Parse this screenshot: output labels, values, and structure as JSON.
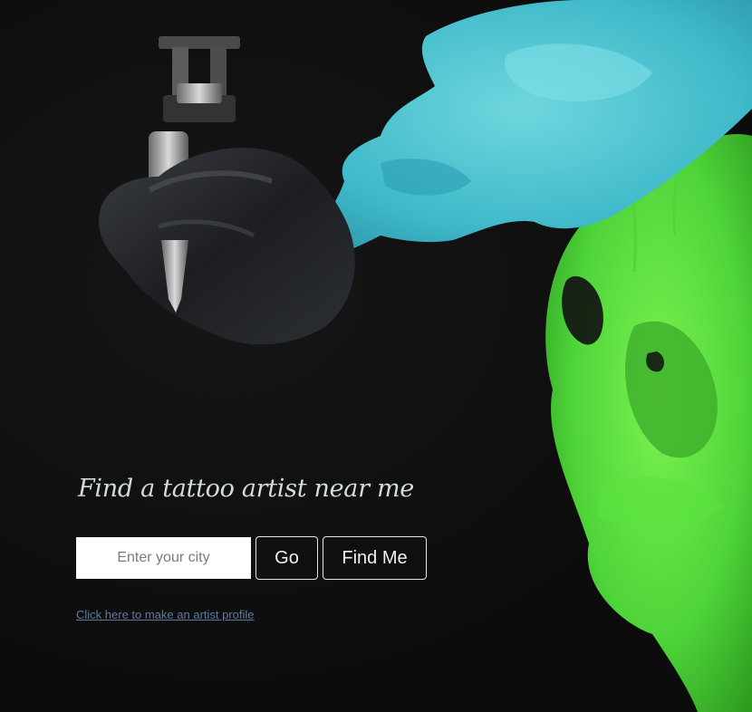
{
  "hero": {
    "title": "Find a tattoo artist near me"
  },
  "search": {
    "placeholder": "Enter your city",
    "value": "",
    "go_label": "Go",
    "find_me_label": "Find Me"
  },
  "links": {
    "artist_profile": "Click here to make an artist profile"
  },
  "colors": {
    "background": "#0e0e0e",
    "title_text": "#d2ddd6",
    "link": "#5f7aa0",
    "ink_blue": "#3fb9c9",
    "ink_green": "#4fd43a"
  },
  "icons": {
    "tattoo_machine": "tattoo-machine-hand-icon"
  }
}
